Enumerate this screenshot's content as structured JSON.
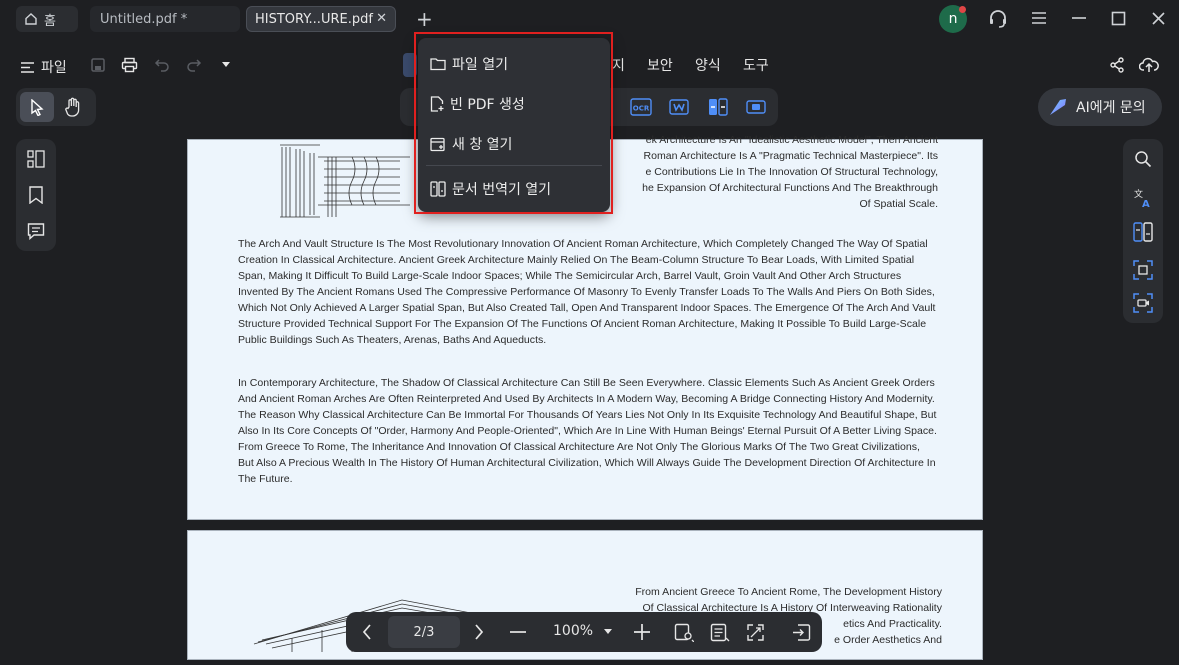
{
  "tabs": {
    "home_label": "홈",
    "tab1_label": "Untitled.pdf *",
    "tab2_label": "HISTORY...URE.pdf",
    "close_glyph": "✕",
    "new_tab_glyph": "+"
  },
  "user": {
    "avatar_letter": "n"
  },
  "menu": {
    "file_label": "파일",
    "items": [
      "지",
      "보안",
      "양식",
      "도구"
    ]
  },
  "ai_button": {
    "label": "AI에게 문의"
  },
  "dropdown": {
    "items": [
      "파일 열기",
      "빈 PDF 생성",
      "새 창 열기",
      "문서 번역기 열기"
    ]
  },
  "document": {
    "intro_lines": [
      "ek Architecture Is An \"Idealistic Aesthetic Model\", Then Ancient",
      "Roman Architecture Is A \"Pragmatic Technical Masterpiece\". Its",
      "e Contributions Lie In The Innovation Of Structural Technology,",
      "he Expansion Of Architectural Functions And The Breakthrough",
      "Of Spatial Scale."
    ],
    "paragraph1": "The Arch And Vault Structure Is The Most Revolutionary Innovation Of Ancient Roman Architecture, Which Completely Changed The Way Of Spatial Creation In Classical Architecture. Ancient Greek Architecture Mainly Relied On The Beam-Column Structure To Bear Loads, With Limited Spatial Span, Making It Difficult To Build Large-Scale Indoor Spaces; While The Semicircular Arch, Barrel Vault, Groin Vault And Other Arch Structures Invented By The Ancient Romans Used The Compressive Performance Of Masonry To Evenly Transfer Loads To The Walls And Piers On Both Sides, Which Not Only Achieved A Larger Spatial Span, But Also Created Tall, Open And Transparent Indoor Spaces. The Emergence Of The Arch And Vault Structure Provided Technical Support For The Expansion Of The Functions Of Ancient Roman Architecture, Making It Possible To Build Large-Scale Public Buildings Such As Theaters, Arenas, Baths And Aqueducts.",
    "paragraph2": "In Contemporary Architecture, The Shadow Of Classical Architecture Can Still Be Seen Everywhere. Classic Elements Such As Ancient Greek Orders And Ancient Roman Arches Are Often Reinterpreted And Used By Architects In A Modern Way, Becoming A Bridge Connecting History And Modernity. The Reason Why Classical Architecture Can Be Immortal For Thousands Of Years Lies Not Only In Its Exquisite Technology And Beautiful Shape, But Also In Its Core Concepts Of \"Order, Harmony And People-Oriented\", Which Are In Line With Human Beings' Eternal Pursuit Of A Better Living Space. From Greece To Rome, The Inheritance And Innovation Of Classical Architecture Are Not Only The Glorious Marks Of The Two Great Civilizations, But Also A Precious Wealth In The History Of Human Architectural Civilization, Which Will Always Guide The Development Direction Of Architecture In The Future.",
    "page2_lines": [
      "From Ancient Greece To Ancient Rome, The Development History",
      "Of Classical Architecture Is A History Of Interweaving Rationality",
      "etics And Practicality.",
      "e Order Aesthetics And"
    ]
  },
  "pager": {
    "page": "2/3",
    "zoom": "100%"
  },
  "colors": {
    "accent_red": "#e0201f",
    "page_bg": "#edf5fc",
    "app_bg": "#1e1f22"
  }
}
